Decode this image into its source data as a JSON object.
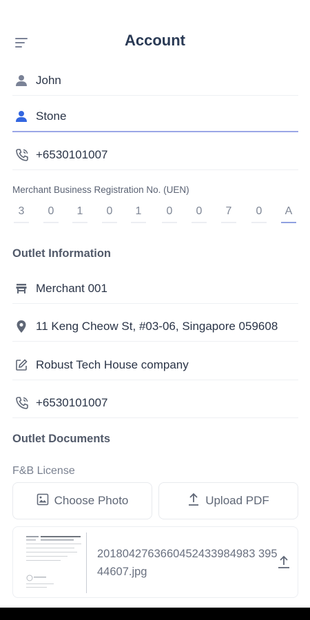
{
  "header": {
    "title": "Account",
    "menu_icon": "menu-icon"
  },
  "profile": {
    "first_name": "John",
    "last_name": "Stone",
    "phone": "+6530101007"
  },
  "uen": {
    "label": "Merchant Business Registration No. (UEN)",
    "digits": [
      "3",
      "0",
      "1",
      "0",
      "1",
      "0",
      "0",
      "7",
      "0",
      "A"
    ]
  },
  "outlet": {
    "section_title": "Outlet Information",
    "name": "Merchant 001",
    "address": "11 Keng Cheow St, #03-06, Singapore 059608",
    "company": "Robust Tech House company",
    "phone": "+6530101007"
  },
  "documents": {
    "section_title": "Outlet Documents",
    "license_label": "F&B License",
    "choose_photo_label": "Choose Photo",
    "upload_pdf_label": "Upload PDF",
    "file_name": "2018042763660452433984983 39544607.jpg"
  },
  "colors": {
    "accent": "#3366e0",
    "underline_active": "#9aa6e6",
    "icon_gray": "#7a8296"
  }
}
